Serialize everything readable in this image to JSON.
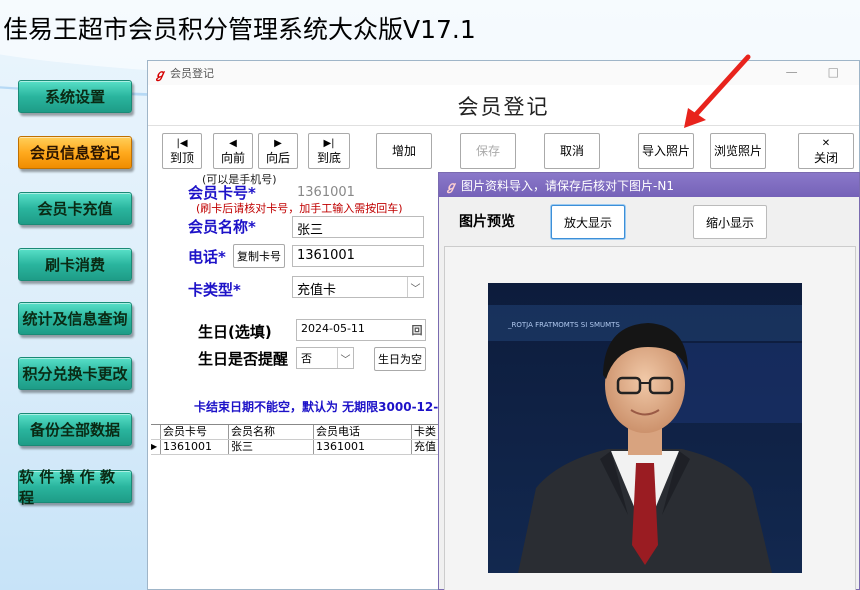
{
  "app": {
    "title": "佳易王超市会员积分管理系统大众版V17.1"
  },
  "nav": {
    "items": [
      {
        "label": "系统设置",
        "active": false
      },
      {
        "label": "会员信息登记",
        "active": true
      },
      {
        "label": "会员卡充值",
        "active": false
      },
      {
        "label": "刷卡消费",
        "active": false
      },
      {
        "label": "统计及信息查询",
        "active": false
      },
      {
        "label": "积分兑换卡更改",
        "active": false
      },
      {
        "label": "备份全部数据",
        "active": false
      },
      {
        "label": "软 件 操 作 教 程",
        "active": false
      }
    ]
  },
  "window": {
    "title": "会员登记",
    "heading": "会员登记",
    "controls": {
      "minimize": "—",
      "maximize": "□"
    }
  },
  "toolbar": {
    "first": {
      "icon": "|◀",
      "label": "到顶"
    },
    "prev": {
      "icon": "◀",
      "label": "向前"
    },
    "next": {
      "icon": "▶",
      "label": "向后"
    },
    "last": {
      "icon": "▶|",
      "label": "到底"
    },
    "add": "增加",
    "save": "保存",
    "cancel": "取消",
    "import_photo": "导入照片",
    "browse_photo": "浏览照片",
    "close": {
      "icon": "✕",
      "label": "关闭"
    }
  },
  "form": {
    "phone_hint": "(可以是手机号)",
    "card_no_label": "会员卡号*",
    "card_no_value": "1361001",
    "card_hint": "(刷卡后请核对卡号，加手工输入需按回车)",
    "name_label": "会员名称*",
    "name_value": "张三",
    "phone_label": "电话*",
    "copy_card_btn": "复制卡号",
    "phone_value": "1361001",
    "card_type_label": "卡类型*",
    "card_type_value": "充值卡",
    "birthday_label": "生日(选填)",
    "birthday_value": "2024-05-11",
    "birthday_picker_icon": "回",
    "remind_label": "生日是否提醒",
    "remind_value": "否",
    "clear_birthday_btn": "生日为空",
    "end_date_note": "卡结束日期不能空，默认为 无期限3000-12-"
  },
  "grid": {
    "columns": [
      "会员卡号",
      "会员名称",
      "会员电话",
      "卡类"
    ],
    "rows": [
      {
        "marker": "▶",
        "card_no": "1361001",
        "name": "张三",
        "phone": "1361001",
        "type": "充值"
      }
    ]
  },
  "dialog": {
    "title": "图片资料导入，请保存后核对下图片-N1",
    "preview_label": "图片预览",
    "zoom_in": "放大显示",
    "zoom_out": "缩小显示",
    "photo_banner_text": "_ROTJA FRATMOMTS SI SMUMTS"
  },
  "colors": {
    "label_blue": "#1d12c8",
    "hint_red": "#c00000",
    "nav_green": "#2ab59e",
    "nav_active_orange": "#ffaa1e",
    "dialog_title_purple": "#7562b8",
    "arrow_red": "#e8231c"
  }
}
